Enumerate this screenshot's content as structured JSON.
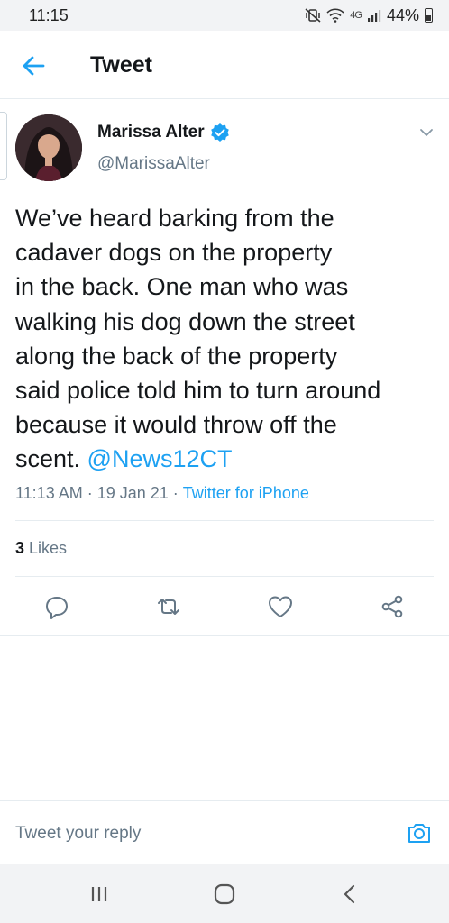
{
  "status_bar": {
    "time": "11:15",
    "network": "4G",
    "battery_percent": "44%",
    "icons": [
      "mute-vibrate-icon",
      "wifi-icon",
      "signal-icon",
      "battery-icon"
    ]
  },
  "header": {
    "title": "Tweet",
    "back_icon": "arrow-left-icon"
  },
  "tweet": {
    "author": {
      "display_name": "Marissa Alter",
      "handle": "@MarissaAlter",
      "verified": true
    },
    "text": "We’ve heard barking from the\ncadaver dogs on the property\nin the back. One man who was\nwalking his dog down the street\nalong the back of the property\nsaid police told him to turn around\nbecause it would throw off the\nscent. ",
    "mention": "@News12CT",
    "time": "11:13 AM",
    "separator": " · ",
    "date": "19 Jan 21",
    "source": "Twitter for iPhone",
    "likes_count": "3",
    "likes_label": " Likes"
  },
  "actions": [
    "reply-icon",
    "retweet-icon",
    "like-icon",
    "share-icon"
  ],
  "reply": {
    "placeholder": "Tweet your reply"
  },
  "colors": {
    "accent": "#1da1f2",
    "muted": "#657786",
    "text": "#14171a",
    "divider": "#e6ecf0"
  }
}
